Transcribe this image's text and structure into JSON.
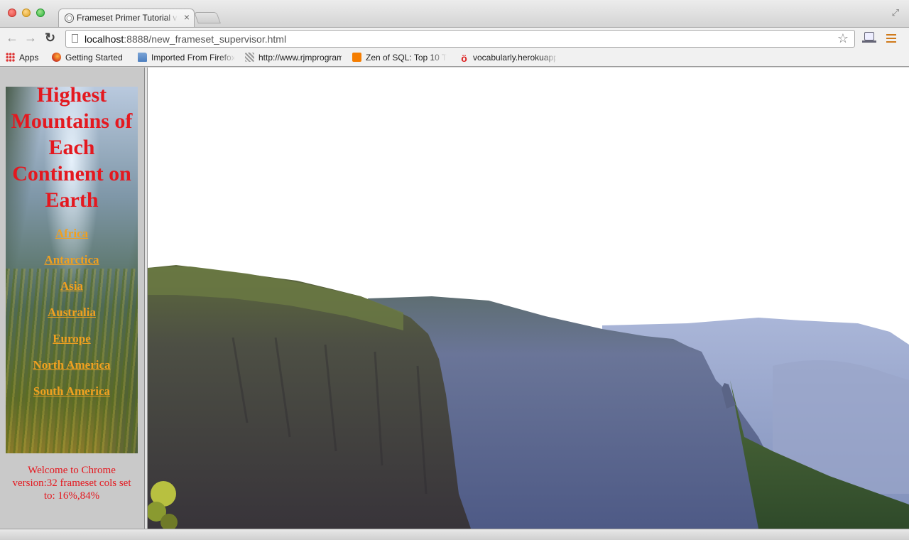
{
  "window": {
    "tab": {
      "title": "Frameset Primer Tutorial via a",
      "close_glyph": "×"
    },
    "toolbar": {
      "back_glyph": "←",
      "forward_glyph": "→",
      "reload_glyph": "↻",
      "url_host": "localhost",
      "url_rest": ":8888/new_frameset_supervisor.html",
      "star_glyph": "☆"
    },
    "bookmarks": [
      {
        "label": "Apps",
        "icon": "apps-grid-icon"
      },
      {
        "label": "Getting Started",
        "icon": "firefox-icon"
      },
      {
        "label": "Imported From Firefox",
        "icon": "folder-icon"
      },
      {
        "label": "http://www.rjmprogramming",
        "icon": "page-icon"
      },
      {
        "label": "Zen of SQL: Top 10 T",
        "icon": "blogger-icon"
      },
      {
        "label": "vocabularly.herokuapp",
        "icon": "vocabularly-icon"
      }
    ]
  },
  "left_frame": {
    "title": "Highest Mountains of Each Continent on Earth",
    "continents": [
      "Africa",
      "Antarctica",
      "Asia",
      "Australia",
      "Europe",
      "North America",
      "South America"
    ],
    "welcome": "Welcome to Chrome version:32 frameset cols set to: 16%,84%"
  },
  "right_frame": {
    "image": "mountain-valley-photo"
  },
  "colors": {
    "title_red": "#e4181f",
    "link_orange": "#f0a020",
    "left_frame_bg": "#c9c9c9"
  }
}
